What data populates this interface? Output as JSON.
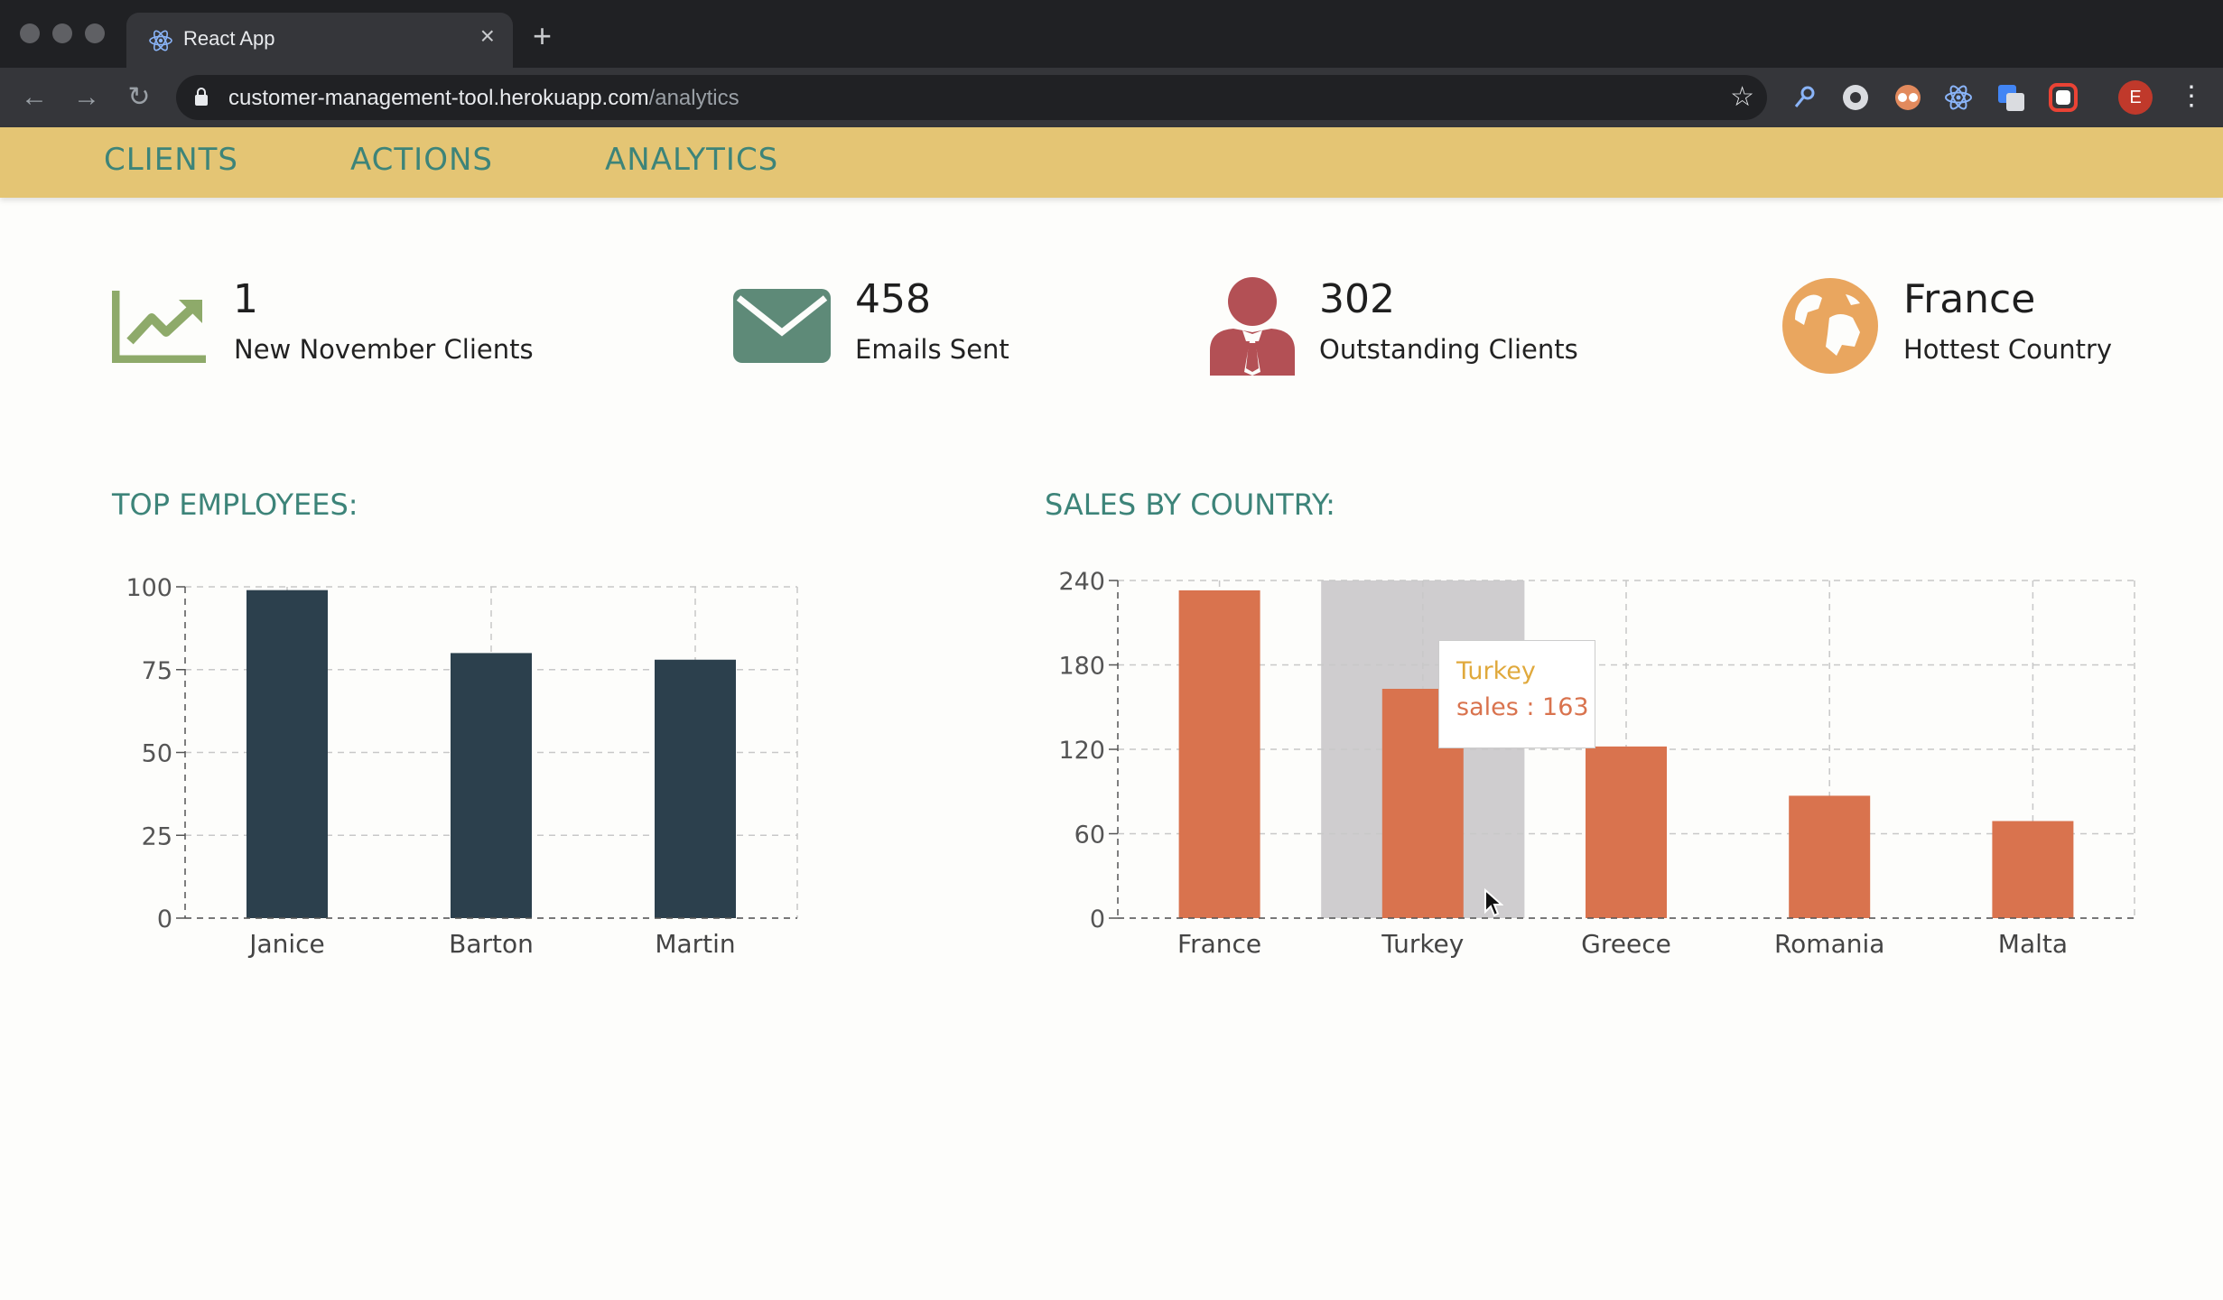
{
  "browser": {
    "tab_title": "React App",
    "tab_close": "×",
    "new_tab": "+",
    "url_host": "customer-management-tool.herokuapp.com",
    "url_path": "/analytics",
    "profile_initial": "E"
  },
  "nav": {
    "items": [
      "CLIENTS",
      "ACTIONS",
      "ANALYTICS"
    ]
  },
  "stats": [
    {
      "value": "1",
      "label": "New November Clients",
      "icon": "trending-up-icon",
      "color": "#8eaa6a"
    },
    {
      "value": "458",
      "label": "Emails Sent",
      "icon": "envelope-icon",
      "color": "#5e8a78"
    },
    {
      "value": "302",
      "label": "Outstanding Clients",
      "icon": "user-tie-icon",
      "color": "#b35055"
    },
    {
      "value": "France",
      "label": "Hottest Country",
      "icon": "globe-icon",
      "color": "#e9a65f"
    }
  ],
  "sections": {
    "employees_title": "TOP EMPLOYEES:",
    "sales_title": "SALES BY COUNTRY:"
  },
  "tooltip": {
    "name": "Turkey",
    "text": "sales : 163"
  },
  "chart_data": [
    {
      "type": "bar",
      "title": "TOP EMPLOYEES:",
      "categories": [
        "Janice",
        "Barton",
        "Martin"
      ],
      "values": [
        99,
        80,
        78
      ],
      "ylim": [
        0,
        100
      ],
      "yticks": [
        0,
        25,
        50,
        75,
        100
      ],
      "color": "#2c404d",
      "grid": true
    },
    {
      "type": "bar",
      "title": "SALES BY COUNTRY:",
      "categories": [
        "France",
        "Turkey",
        "Greece",
        "Romania",
        "Malta"
      ],
      "values": [
        233,
        163,
        122,
        87,
        69
      ],
      "ylim": [
        0,
        240
      ],
      "yticks": [
        0,
        60,
        120,
        180,
        240
      ],
      "color": "#d9734e",
      "highlight_category": "Turkey",
      "grid": true
    }
  ]
}
